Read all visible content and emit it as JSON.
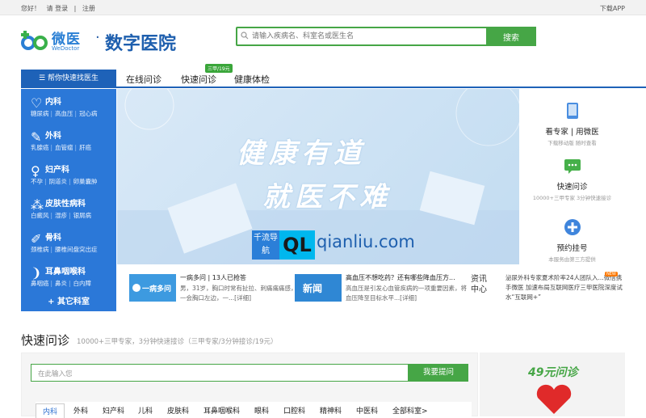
{
  "topbar": {
    "greeting": "您好！",
    "login": "请 登录",
    "divider": "|",
    "register": "注册",
    "download": "下载APP"
  },
  "logo": {
    "cn": "微医",
    "en": "WeDoctor",
    "dot": "·",
    "title": "数字医院"
  },
  "search": {
    "placeholder": "请输入疾病名、科室名或医生名",
    "button": "搜索"
  },
  "nav": {
    "find_doctor": "帮你快速找医生",
    "items": [
      "在线问诊",
      "快速问诊",
      "健康体检"
    ],
    "badge": "三甲/19元"
  },
  "sidebar": {
    "categories": [
      {
        "name": "内科",
        "icon": "heart-icon",
        "subs": [
          "糖尿病",
          "高血压",
          "冠心病"
        ]
      },
      {
        "name": "外科",
        "icon": "bone-icon",
        "subs": [
          "乳腺癌",
          "血管瘤",
          "肝癌"
        ]
      },
      {
        "name": "妇产科",
        "icon": "female-icon",
        "subs": [
          "不孕",
          "阴道炎",
          "卵巢囊肿"
        ]
      },
      {
        "name": "皮肤性病科",
        "icon": "skin-icon",
        "subs": [
          "白癜风",
          "湿疹",
          "银屑病"
        ]
      },
      {
        "name": "骨科",
        "icon": "bone-joint-icon",
        "subs": [
          "颈椎病",
          "腰椎间盘突出症"
        ]
      },
      {
        "name": "耳鼻咽喉科",
        "icon": "ear-icon",
        "subs": [
          "鼻咽癌",
          "鼻炎",
          "白内障"
        ]
      }
    ],
    "other": "其它科室"
  },
  "banner": {
    "line1": "健康有道",
    "line2": "就医不难"
  },
  "watermark": {
    "box": "千流导航",
    "mark": "QL",
    "site": "qianliu.com"
  },
  "services": [
    {
      "name": "看专家 | 用微医",
      "desc": "下载移动版 随时查看",
      "icon": "phone-icon"
    },
    {
      "name": "快速问诊",
      "desc": "10000+三甲专家 3分钟快速接诊",
      "icon": "chat-icon"
    },
    {
      "name": "预约挂号",
      "desc": "本服务由第三方提供",
      "icon": "plus-icon"
    }
  ],
  "news": [
    {
      "title": "一病多问 | 13人已抢答",
      "text": "男，31岁，胸口时常有扯拉、刺痛痛痛感，一会胸口左边，一...[详细]",
      "img": "一病多问"
    },
    {
      "title": "高血压不想吃药？还有哪些降血压方...",
      "text": "高血压是引发心血管疾病的一项重要因素，将血压降至目标水平...[详细]",
      "img": "新闻"
    }
  ],
  "info_center": {
    "label": "资讯中心",
    "hot": "NEW",
    "text": "泌尿外科专家夏术阶率24人团队入...微信携手微医 加速布局互联网医疗三甲医院深度试水“互联网+”"
  },
  "quick": {
    "title": "快速问诊",
    "sub": "10000+三甲专家，3分钟快速接诊（三甲专家/3分钟接诊/19元）",
    "placeholder": "在此输入您",
    "button": "我要提问",
    "tabs": [
      "内科",
      "外科",
      "妇产科",
      "儿科",
      "皮肤科",
      "耳鼻咽喉科",
      "眼科",
      "口腔科",
      "精神科",
      "中医科",
      "全部科室>"
    ]
  },
  "ad": {
    "title": "49元问诊"
  },
  "colors": {
    "brand_blue": "#1e62b8",
    "green": "#46a646",
    "sidebar": "#2b78d8"
  }
}
